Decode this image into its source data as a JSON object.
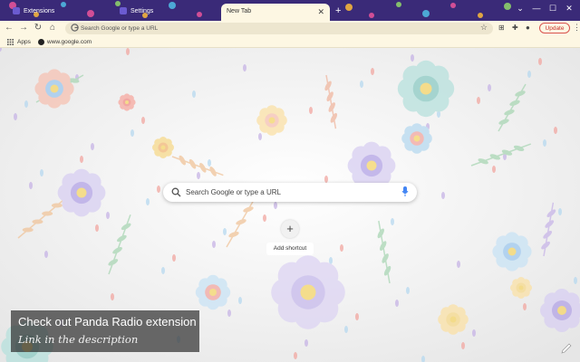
{
  "tabs": [
    {
      "label": "Extensions",
      "active": false
    },
    {
      "label": "Settings",
      "active": false
    },
    {
      "label": "New Tab",
      "active": true
    }
  ],
  "toolbar": {
    "omnibox_placeholder": "Search Google or type a URL",
    "update_label": "Update"
  },
  "bookmarks": {
    "apps_label": "Apps",
    "items": [
      "www.google.com"
    ]
  },
  "ntp": {
    "search_placeholder": "Search Google or type a URL",
    "shortcut_label": "Add shortcut",
    "shortcut_glyph": "+"
  },
  "promo": {
    "headline": "Check out Panda Radio extension",
    "subline": "Link in the description"
  },
  "theme": {
    "tabbar_color": "#3a2a78",
    "toolbar_color": "#fdf7e3",
    "accent_red": "#d9534f"
  }
}
